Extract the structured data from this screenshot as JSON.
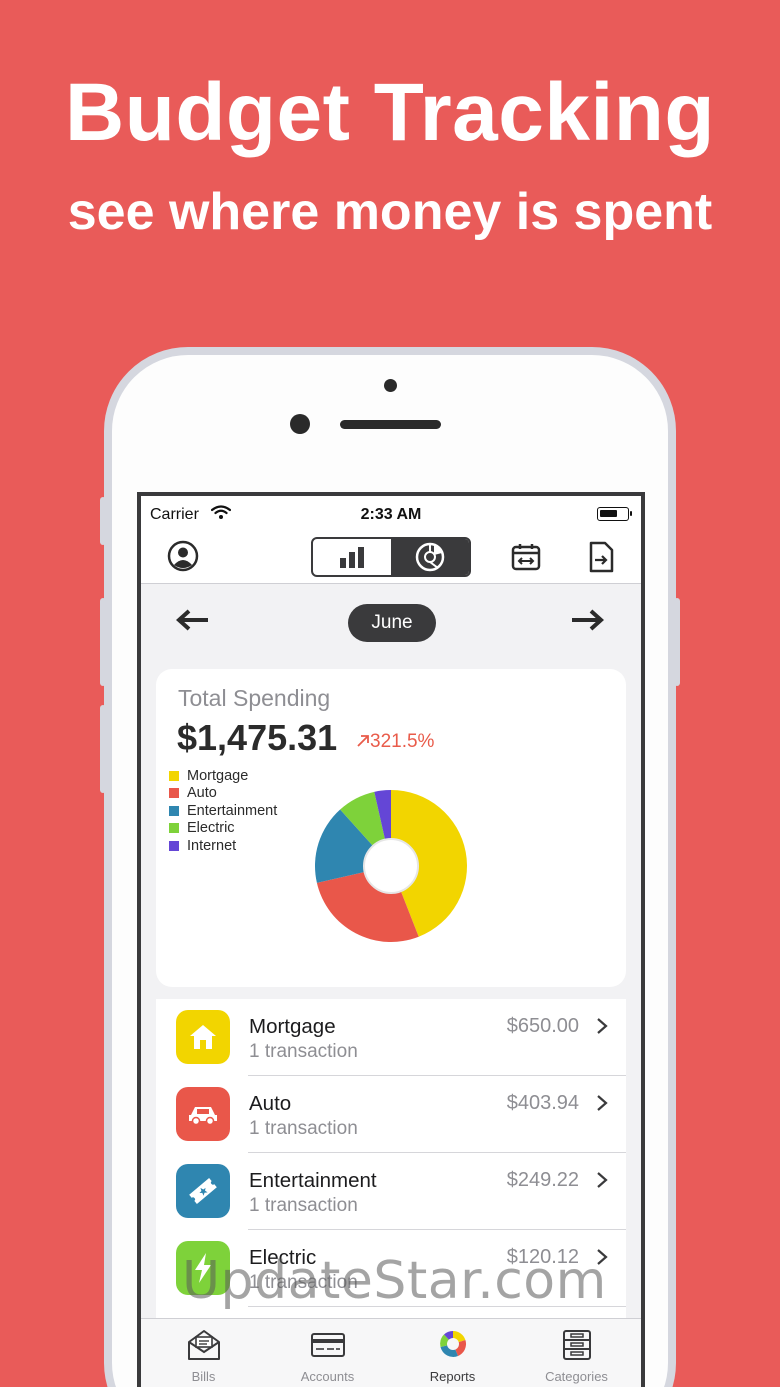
{
  "promo": {
    "headline": "Budget Tracking",
    "subline": "see where money is spent"
  },
  "status_bar": {
    "carrier": "Carrier",
    "time": "2:33 AM"
  },
  "month_nav": {
    "month": "June"
  },
  "summary": {
    "title": "Total Spending",
    "total": "$1,475.31",
    "change": "321.5%"
  },
  "legend": [
    {
      "label": "Mortgage",
      "color": "#f2d500"
    },
    {
      "label": "Auto",
      "color": "#e9574a"
    },
    {
      "label": "Entertainment",
      "color": "#2f86b0"
    },
    {
      "label": "Electric",
      "color": "#7ed23a"
    },
    {
      "label": "Internet",
      "color": "#6446d6"
    }
  ],
  "chart_data": {
    "type": "pie",
    "categories": [
      "Mortgage",
      "Auto",
      "Entertainment",
      "Electric",
      "Internet"
    ],
    "values": [
      650.0,
      403.94,
      249.22,
      120.12,
      52.03
    ],
    "colors": [
      "#f2d500",
      "#e9574a",
      "#2f86b0",
      "#7ed23a",
      "#6446d6"
    ],
    "donut": true
  },
  "categories": [
    {
      "name": "Mortgage",
      "count": "1 transaction",
      "amount": "$650.00",
      "color": "#f2d500",
      "icon": "house-icon"
    },
    {
      "name": "Auto",
      "count": "1 transaction",
      "amount": "$403.94",
      "color": "#e9574a",
      "icon": "car-icon"
    },
    {
      "name": "Entertainment",
      "count": "1 transaction",
      "amount": "$249.22",
      "color": "#2f86b0",
      "icon": "ticket-icon"
    },
    {
      "name": "Electric",
      "count": "1 transaction",
      "amount": "$120.12",
      "color": "#7ed23a",
      "icon": "lightning-icon"
    }
  ],
  "tabs": [
    {
      "label": "Bills",
      "icon": "envelope-icon"
    },
    {
      "label": "Accounts",
      "icon": "card-icon"
    },
    {
      "label": "Reports",
      "icon": "reports-icon",
      "active": true
    },
    {
      "label": "Categories",
      "icon": "cabinet-icon"
    }
  ],
  "watermark": "UpdateStar.com"
}
